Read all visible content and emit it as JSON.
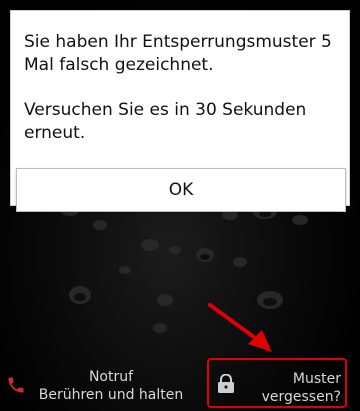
{
  "dialog": {
    "line1": "Sie haben Ihr Entsperrungsmuster 5 Mal falsch gezeichnet.",
    "line2": "Versuchen Sie es in 30 Sekunden erneut.",
    "ok_label": "OK"
  },
  "emergency": {
    "title": "Notruf",
    "subtitle": "Berühren und halten",
    "icon": "phone-icon"
  },
  "forgot_pattern": {
    "line1": "Muster",
    "line2": "vergessen?",
    "icon": "lock-icon"
  },
  "colors": {
    "highlight": "#e00000",
    "phone_icon": "#d42a2a"
  }
}
